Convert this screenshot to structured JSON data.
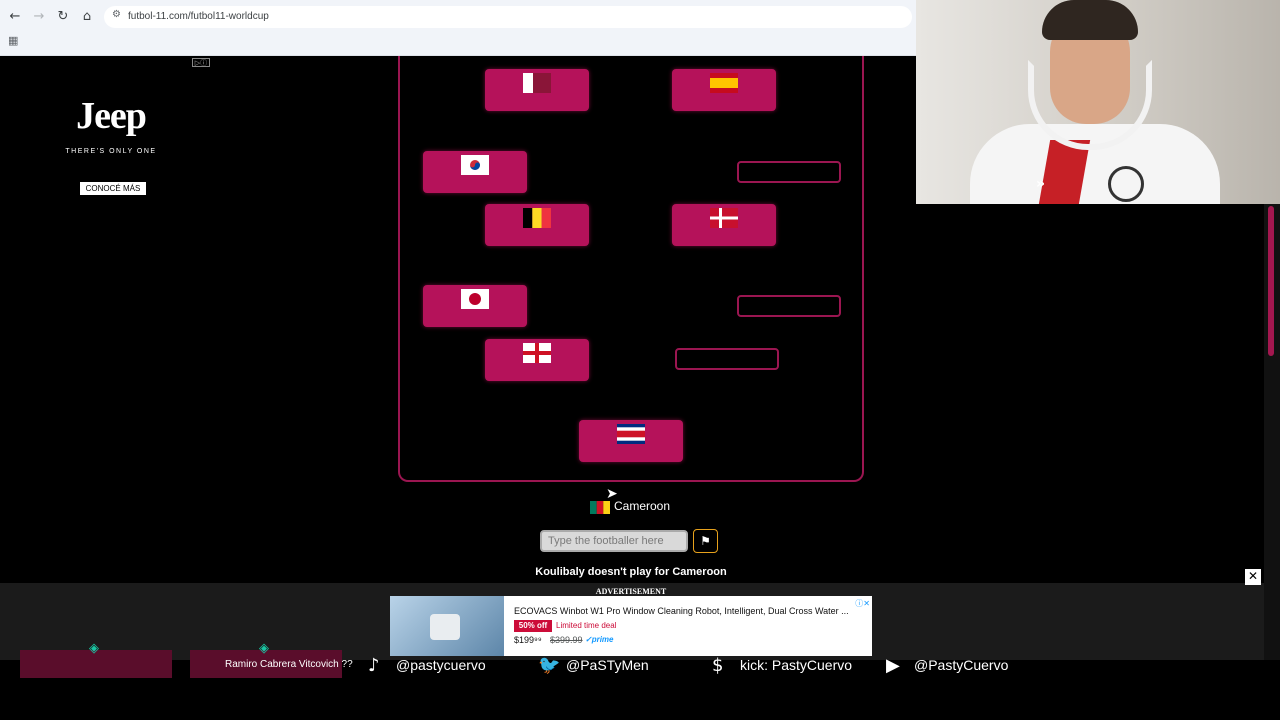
{
  "browser": {
    "url": "futbol-11.com/futbol11-worldcup",
    "back_icon": "arrow-left",
    "forward_icon": "arrow-right",
    "reload_icon": "reload",
    "home_icon": "home",
    "apps_icon": "apps-grid"
  },
  "jeep_ad": {
    "brand": "Jeep",
    "tagline": "THERE'S ONLY ONE",
    "cta": "CONOCÉ MÁS"
  },
  "game": {
    "filled_cards": [
      {
        "flag": "qatar"
      },
      {
        "flag": "spain"
      },
      {
        "flag": "south-korea"
      },
      {
        "flag": "belgium"
      },
      {
        "flag": "denmark"
      },
      {
        "flag": "japan"
      },
      {
        "flag": "england"
      },
      {
        "flag": "costa-rica"
      }
    ],
    "empty_slots": 3,
    "current_country": "Cameroon",
    "input_placeholder": "Type the footballer here",
    "feedback": "Koulibaly doesn't play for Cameroon"
  },
  "bottom_ad": {
    "label": "ADVERTISEMENT",
    "title": "ECOVACS Winbot W1 Pro Window Cleaning Robot, Intelligent, Dual Cross Water ...",
    "deal_badge": "50% off",
    "deal_text": "Limited time deal",
    "price": "$199⁹⁹",
    "old_price": "$399.99",
    "prime": "✓prime",
    "close": "✕"
  },
  "overlay": {
    "donor_name": "Ramiro Cabrera Vitcovich ??",
    "socials": [
      {
        "icon": "tiktok-icon",
        "glyph": "♪",
        "text": "@pastycuervo"
      },
      {
        "icon": "twitter-icon",
        "glyph": "🐦",
        "text": "@PaSTyMen"
      },
      {
        "icon": "kick-icon",
        "glyph": "$",
        "text": "kick: PastyCuervo"
      },
      {
        "icon": "youtube-icon",
        "glyph": "▶",
        "text": "@PastyCuervo"
      }
    ]
  },
  "colors": {
    "card": "#b5125a",
    "border": "#9b1651",
    "accent": "#e8a21c"
  }
}
